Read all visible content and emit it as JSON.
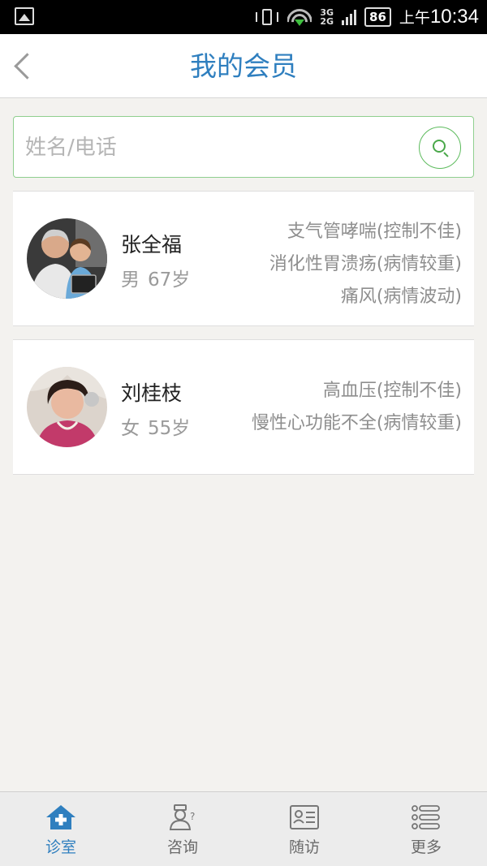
{
  "status_bar": {
    "network": "3G\n2G",
    "battery": "86",
    "ampm": "上午",
    "time": "10:34"
  },
  "header": {
    "title": "我的会员",
    "back_icon": "chevron-left-icon"
  },
  "search": {
    "placeholder": "姓名/电话",
    "value": "",
    "icon": "search-icon",
    "accent": "#5dbb5d"
  },
  "members": [
    {
      "name": "张全福",
      "gender": "男",
      "age": "67岁",
      "conditions": [
        "支气管哮喘(控制不佳)",
        "消化性胃溃疡(病情较重)",
        "痛风(病情波动)"
      ]
    },
    {
      "name": "刘桂枝",
      "gender": "女",
      "age": "55岁",
      "conditions": [
        "高血压(控制不佳)",
        "慢性心功能不全(病情较重)"
      ]
    }
  ],
  "bottom_nav": {
    "active_color": "#2f7fbf",
    "items": [
      {
        "label": "诊室",
        "icon": "home-plus-icon",
        "active": true
      },
      {
        "label": "咨询",
        "icon": "doctor-question-icon",
        "active": false
      },
      {
        "label": "随访",
        "icon": "id-card-icon",
        "active": false
      },
      {
        "label": "更多",
        "icon": "list-icon",
        "active": false
      }
    ]
  }
}
